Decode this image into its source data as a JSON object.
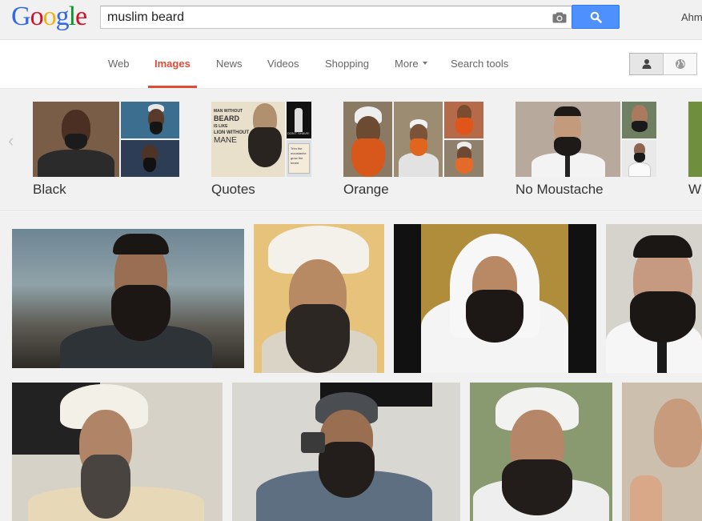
{
  "logo": {
    "letters": [
      "G",
      "o",
      "o",
      "g",
      "l",
      "e"
    ],
    "colors": [
      "#3369e8",
      "#d50f25",
      "#eeb211",
      "#3369e8",
      "#009925",
      "#d50f25"
    ]
  },
  "search": {
    "query": "muslim beard",
    "camera_icon": "camera-icon",
    "button_icon": "search-icon",
    "accent": "#4d90fe"
  },
  "user": {
    "name": "Ahm"
  },
  "tabs": [
    {
      "label": "Web",
      "active": false
    },
    {
      "label": "Images",
      "active": true
    },
    {
      "label": "News",
      "active": false
    },
    {
      "label": "Videos",
      "active": false
    },
    {
      "label": "Shopping",
      "active": false
    },
    {
      "label": "More",
      "active": false
    },
    {
      "label": "Search tools",
      "active": false
    }
  ],
  "active_color": "#dd4b39",
  "related": [
    {
      "label": "Black"
    },
    {
      "label": "Quotes",
      "quote_lines": [
        "MAN WITHOUT",
        "BEARD",
        "IS LIKE",
        "LION WITHOUT",
        "MANE"
      ],
      "quote_side": [
        "DON'T SHAVE!",
        "Trim the moustache",
        "grow the beard"
      ]
    },
    {
      "label": "Orange"
    },
    {
      "label": "No Moustache"
    },
    {
      "label": "W"
    }
  ]
}
